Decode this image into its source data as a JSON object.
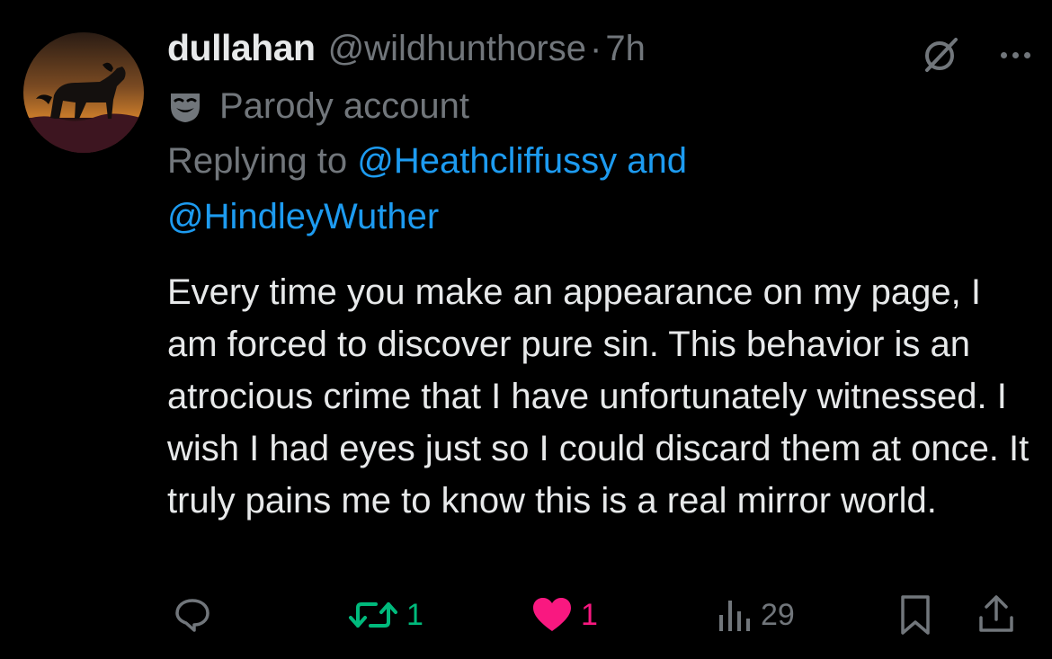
{
  "post": {
    "display_name": "dullahan",
    "handle": "@wildhunthorse",
    "separator": "·",
    "time": "7h",
    "badge_label": "Parody account",
    "replying_prefix": "Replying to",
    "reply_mention_1": "@Heathcliffussy",
    "reply_conjunction": "and",
    "reply_mention_2": "@HindleyWuther",
    "text": "Every time you make an appearance on my page, I am forced to discover pure sin. This behavior is an atrocious crime that I have unfortunately witnessed. I wish I had eyes just so I could discard them at once. It truly pains me to know this is a real mirror world."
  },
  "actions": {
    "reposts": "1",
    "likes": "1",
    "views": "29"
  },
  "colors": {
    "background": "#000000",
    "text_primary": "#e7e9ea",
    "text_secondary": "#71767b",
    "link": "#1d9bf0",
    "repost_active": "#00ba7c",
    "like_active": "#f91880"
  },
  "icons": [
    "grok-icon",
    "more-icon",
    "parody-mask-icon",
    "reply-icon",
    "repost-icon",
    "like-icon",
    "views-icon",
    "bookmark-icon",
    "share-icon"
  ]
}
